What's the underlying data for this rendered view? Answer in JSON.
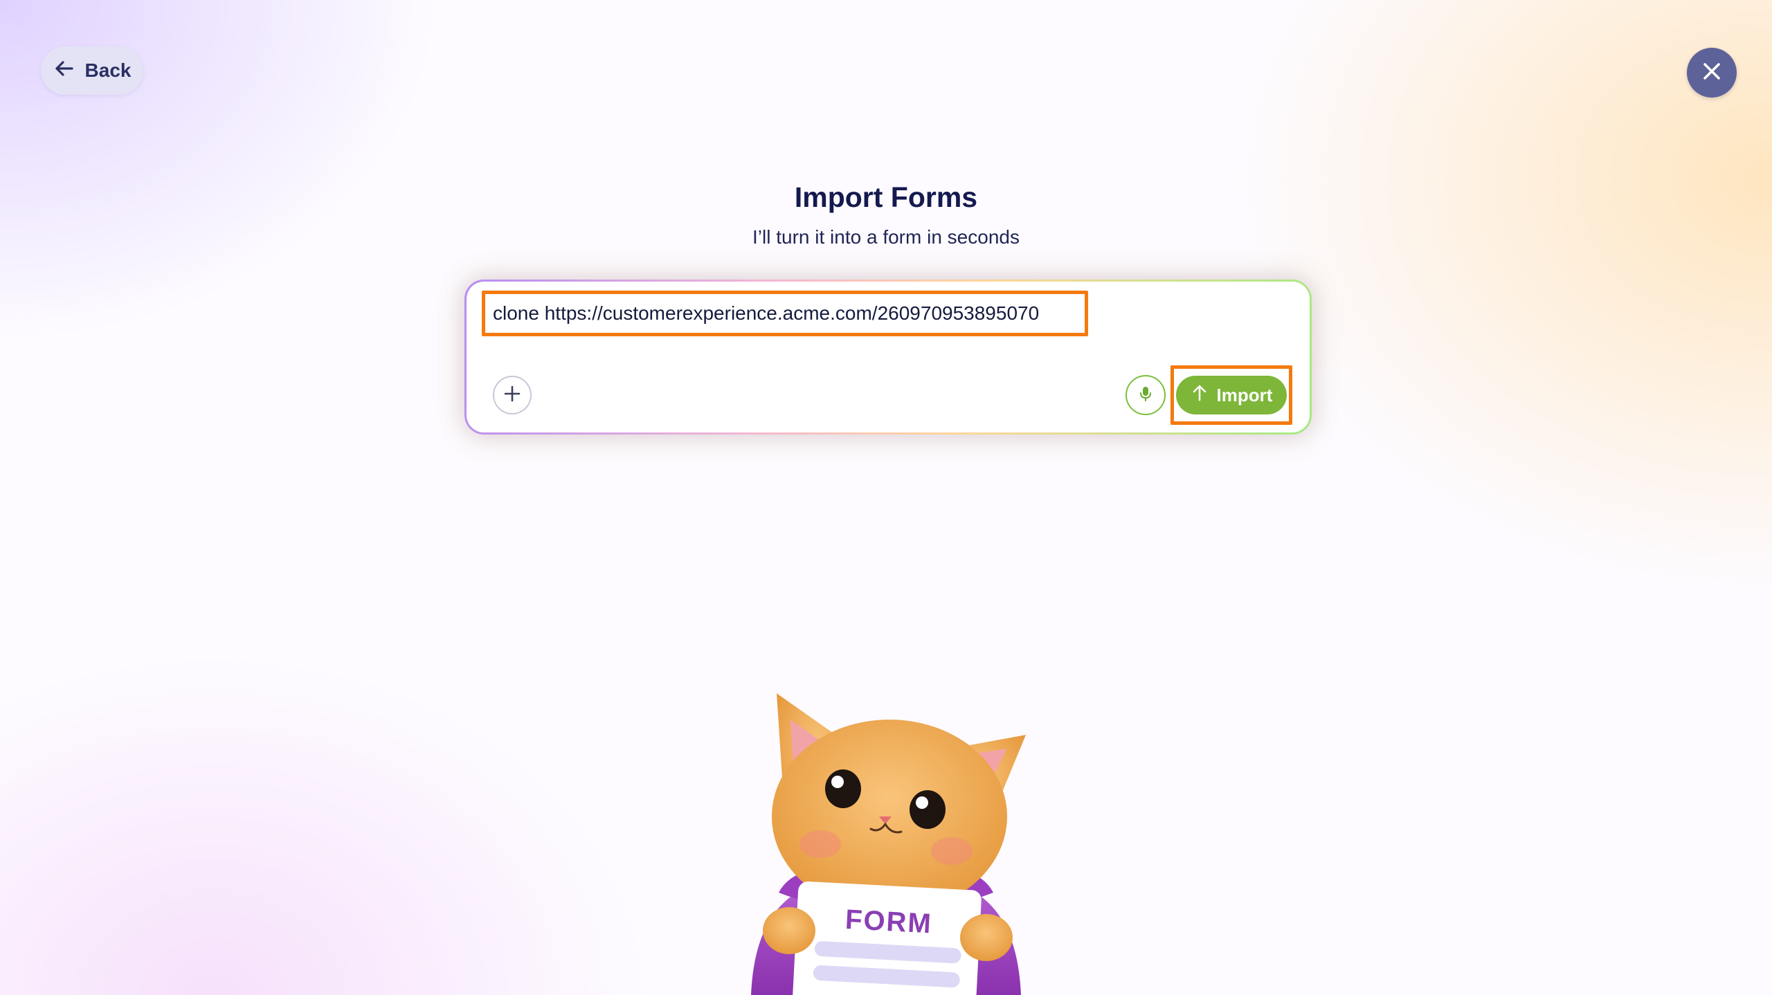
{
  "nav": {
    "back_label": "Back"
  },
  "header": {
    "title": "Import Forms",
    "subtitle": "I’ll turn it into a form in seconds"
  },
  "prompt": {
    "value": "clone https://customerexperience.acme.com/260970953895070",
    "import_label": "Import"
  },
  "illustration": {
    "sign_text": "FORM"
  },
  "colors": {
    "accent_green": "#7db638",
    "highlight_orange": "#f47a0e",
    "close_button": "#5d6299",
    "title_navy": "#141a4f"
  }
}
